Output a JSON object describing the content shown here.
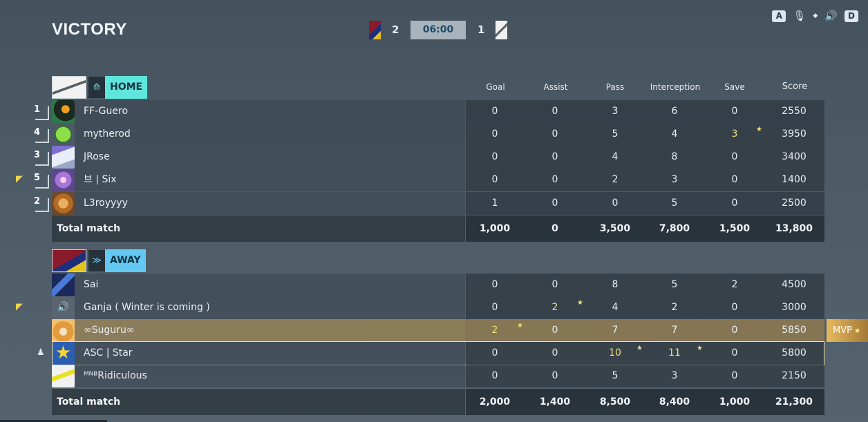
{
  "header": {
    "title": "VICTORY",
    "home_score": "2",
    "timer": "06:00",
    "away_score": "1"
  },
  "hud": {
    "key_left": "A",
    "key_right": "D",
    "icons": [
      "mic-icon",
      "dot-icon",
      "speaker-icon"
    ]
  },
  "columns": [
    "Goal",
    "Assist",
    "Pass",
    "Interception",
    "Save",
    "Score"
  ],
  "home": {
    "name": "HOME",
    "players": [
      {
        "rank": "1",
        "name": "FF-Guero",
        "goal": "0",
        "assist": "0",
        "pass": "3",
        "interception": "6",
        "save": "0",
        "score": "2550"
      },
      {
        "rank": "4",
        "name": "mytherod",
        "goal": "0",
        "assist": "0",
        "pass": "5",
        "interception": "4",
        "save": "3",
        "score": "3950"
      },
      {
        "rank": "3",
        "name": "JRose",
        "goal": "0",
        "assist": "0",
        "pass": "4",
        "interception": "8",
        "save": "0",
        "score": "3400"
      },
      {
        "rank": "5",
        "name": "브 | Six",
        "goal": "0",
        "assist": "0",
        "pass": "2",
        "interception": "3",
        "save": "0",
        "score": "1400"
      },
      {
        "rank": "2",
        "name": "L3royyyy",
        "goal": "1",
        "assist": "0",
        "pass": "0",
        "interception": "5",
        "save": "0",
        "score": "2500"
      }
    ],
    "total": {
      "label": "Total match",
      "goal": "1,000",
      "assist": "0",
      "pass": "3,500",
      "interception": "7,800",
      "save": "1,500",
      "score": "13,800"
    }
  },
  "away": {
    "name": "AWAY",
    "players": [
      {
        "name": "Sai",
        "goal": "0",
        "assist": "0",
        "pass": "8",
        "interception": "5",
        "save": "2",
        "score": "4500"
      },
      {
        "name": "Ganja ( Winter is coming )",
        "goal": "0",
        "assist": "2",
        "pass": "4",
        "interception": "2",
        "save": "0",
        "score": "3000"
      },
      {
        "name": "∞Suguru∞",
        "goal": "2",
        "assist": "0",
        "pass": "7",
        "interception": "7",
        "save": "0",
        "score": "5850"
      },
      {
        "name": "ASC | Star",
        "goal": "0",
        "assist": "0",
        "pass": "10",
        "interception": "11",
        "save": "0",
        "score": "5800"
      },
      {
        "name": "ᴹᴺᴮRidiculous",
        "goal": "0",
        "assist": "0",
        "pass": "5",
        "interception": "3",
        "save": "0",
        "score": "2150"
      }
    ],
    "total": {
      "label": "Total match",
      "goal": "2,000",
      "assist": "1,400",
      "pass": "8,500",
      "interception": "8,400",
      "save": "1,000",
      "score": "21,300"
    }
  },
  "mvp_label": "MVP",
  "colors": {
    "home_accent": "#5fe6dc",
    "away_accent": "#63c8f2",
    "highlight": "#f3e27a",
    "mvp": "#e7b95f"
  }
}
